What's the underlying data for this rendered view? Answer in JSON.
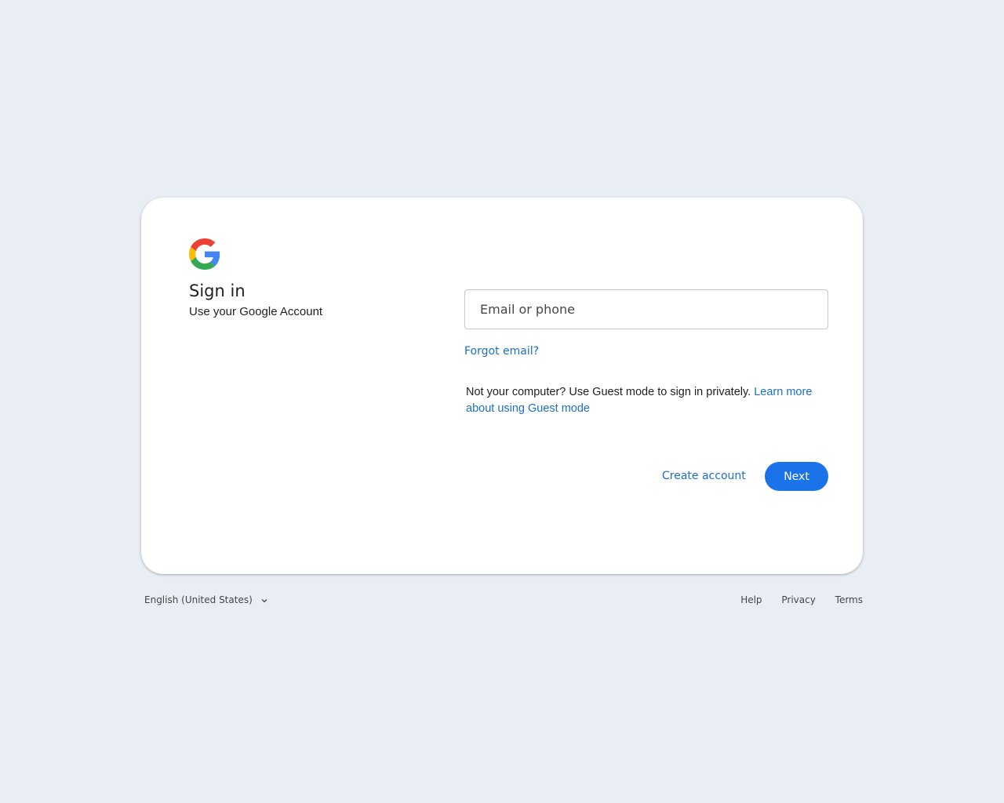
{
  "header": {
    "title": "Sign in",
    "subtitle": "Use your Google Account"
  },
  "form": {
    "email_placeholder": "Email or phone",
    "email_value": "",
    "forgot_email": "Forgot email?",
    "guest_text": "Not your computer? Use Guest mode to sign in privately.",
    "guest_link": "Learn more about using Guest mode",
    "create_account": "Create account",
    "next": "Next"
  },
  "footer": {
    "language": "English (United States)",
    "links": [
      "Help",
      "Privacy",
      "Terms"
    ]
  },
  "colors": {
    "background": "#e9edf4",
    "primary": "#1a73e8",
    "link": "#1a6fc9",
    "text": "#1f1f1f"
  },
  "icons": {
    "logo": "google-g-logo-icon",
    "language_dropdown": "chevron-down-icon"
  }
}
